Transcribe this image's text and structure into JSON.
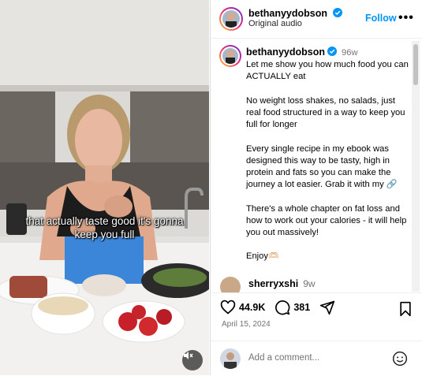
{
  "video": {
    "caption_line1": "that actually taste good it's gonna",
    "caption_line2": "keep you full"
  },
  "header": {
    "username": "bethanyydobson",
    "subtitle": "Original audio",
    "follow_label": "Follow",
    "more_label": "•••"
  },
  "post": {
    "username": "bethanyydobson",
    "time": "96w",
    "paragraphs": [
      "Let me show you how much food you can ACTUALLY eat",
      "No weight loss shakes, no salads, just real food structured in a way to keep you full for longer",
      "Every single recipe in my ebook was designed this way to be tasty, high in protein and fats so you can make the journey a lot easier. Grab it with my 🔗",
      "There's a whole chapter on fat loss and how to work out your calories - it will help you out massively!",
      "Enjoy🫶🏻"
    ]
  },
  "comment": {
    "username": "sherryxshi",
    "time": "9w"
  },
  "actions": {
    "likes": "44.9K",
    "comments": "381",
    "date": "April 15, 2024"
  },
  "add_comment": {
    "placeholder": "Add a comment..."
  }
}
